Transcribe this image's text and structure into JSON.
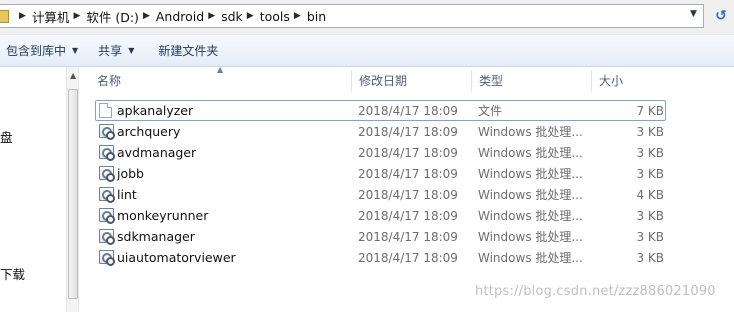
{
  "address_bar": {
    "breadcrumbs": [
      "计算机",
      "软件 (D:)",
      "Android",
      "sdk",
      "tools",
      "bin"
    ],
    "folder_icon": "folder-icon",
    "refresh_icon": "refresh-icon"
  },
  "toolbar": {
    "include_label": "包含到库中",
    "share_label": "共享",
    "new_folder_label": "新建文件夹"
  },
  "nav_pane": {
    "item_disk_fragment": "盘",
    "item_download_fragment": "下载"
  },
  "columns": {
    "name": "名称",
    "date": "修改日期",
    "type": "类型",
    "size": "大小"
  },
  "files": [
    {
      "name": "apkanalyzer",
      "date": "2018/4/17 18:09",
      "type": "文件",
      "size": "7 KB",
      "icon": "file-icon"
    },
    {
      "name": "archquery",
      "date": "2018/4/17 18:09",
      "type": "Windows 批处理...",
      "size": "3 KB",
      "icon": "batch-file-icon"
    },
    {
      "name": "avdmanager",
      "date": "2018/4/17 18:09",
      "type": "Windows 批处理...",
      "size": "3 KB",
      "icon": "batch-file-icon"
    },
    {
      "name": "jobb",
      "date": "2018/4/17 18:09",
      "type": "Windows 批处理...",
      "size": "3 KB",
      "icon": "batch-file-icon"
    },
    {
      "name": "lint",
      "date": "2018/4/17 18:09",
      "type": "Windows 批处理...",
      "size": "4 KB",
      "icon": "batch-file-icon"
    },
    {
      "name": "monkeyrunner",
      "date": "2018/4/17 18:09",
      "type": "Windows 批处理...",
      "size": "3 KB",
      "icon": "batch-file-icon"
    },
    {
      "name": "sdkmanager",
      "date": "2018/4/17 18:09",
      "type": "Windows 批处理...",
      "size": "3 KB",
      "icon": "batch-file-icon"
    },
    {
      "name": "uiautomatorviewer",
      "date": "2018/4/17 18:09",
      "type": "Windows 批处理...",
      "size": "3 KB",
      "icon": "batch-file-icon"
    }
  ],
  "watermark": "https://blog.csdn.net/zzz886021090"
}
